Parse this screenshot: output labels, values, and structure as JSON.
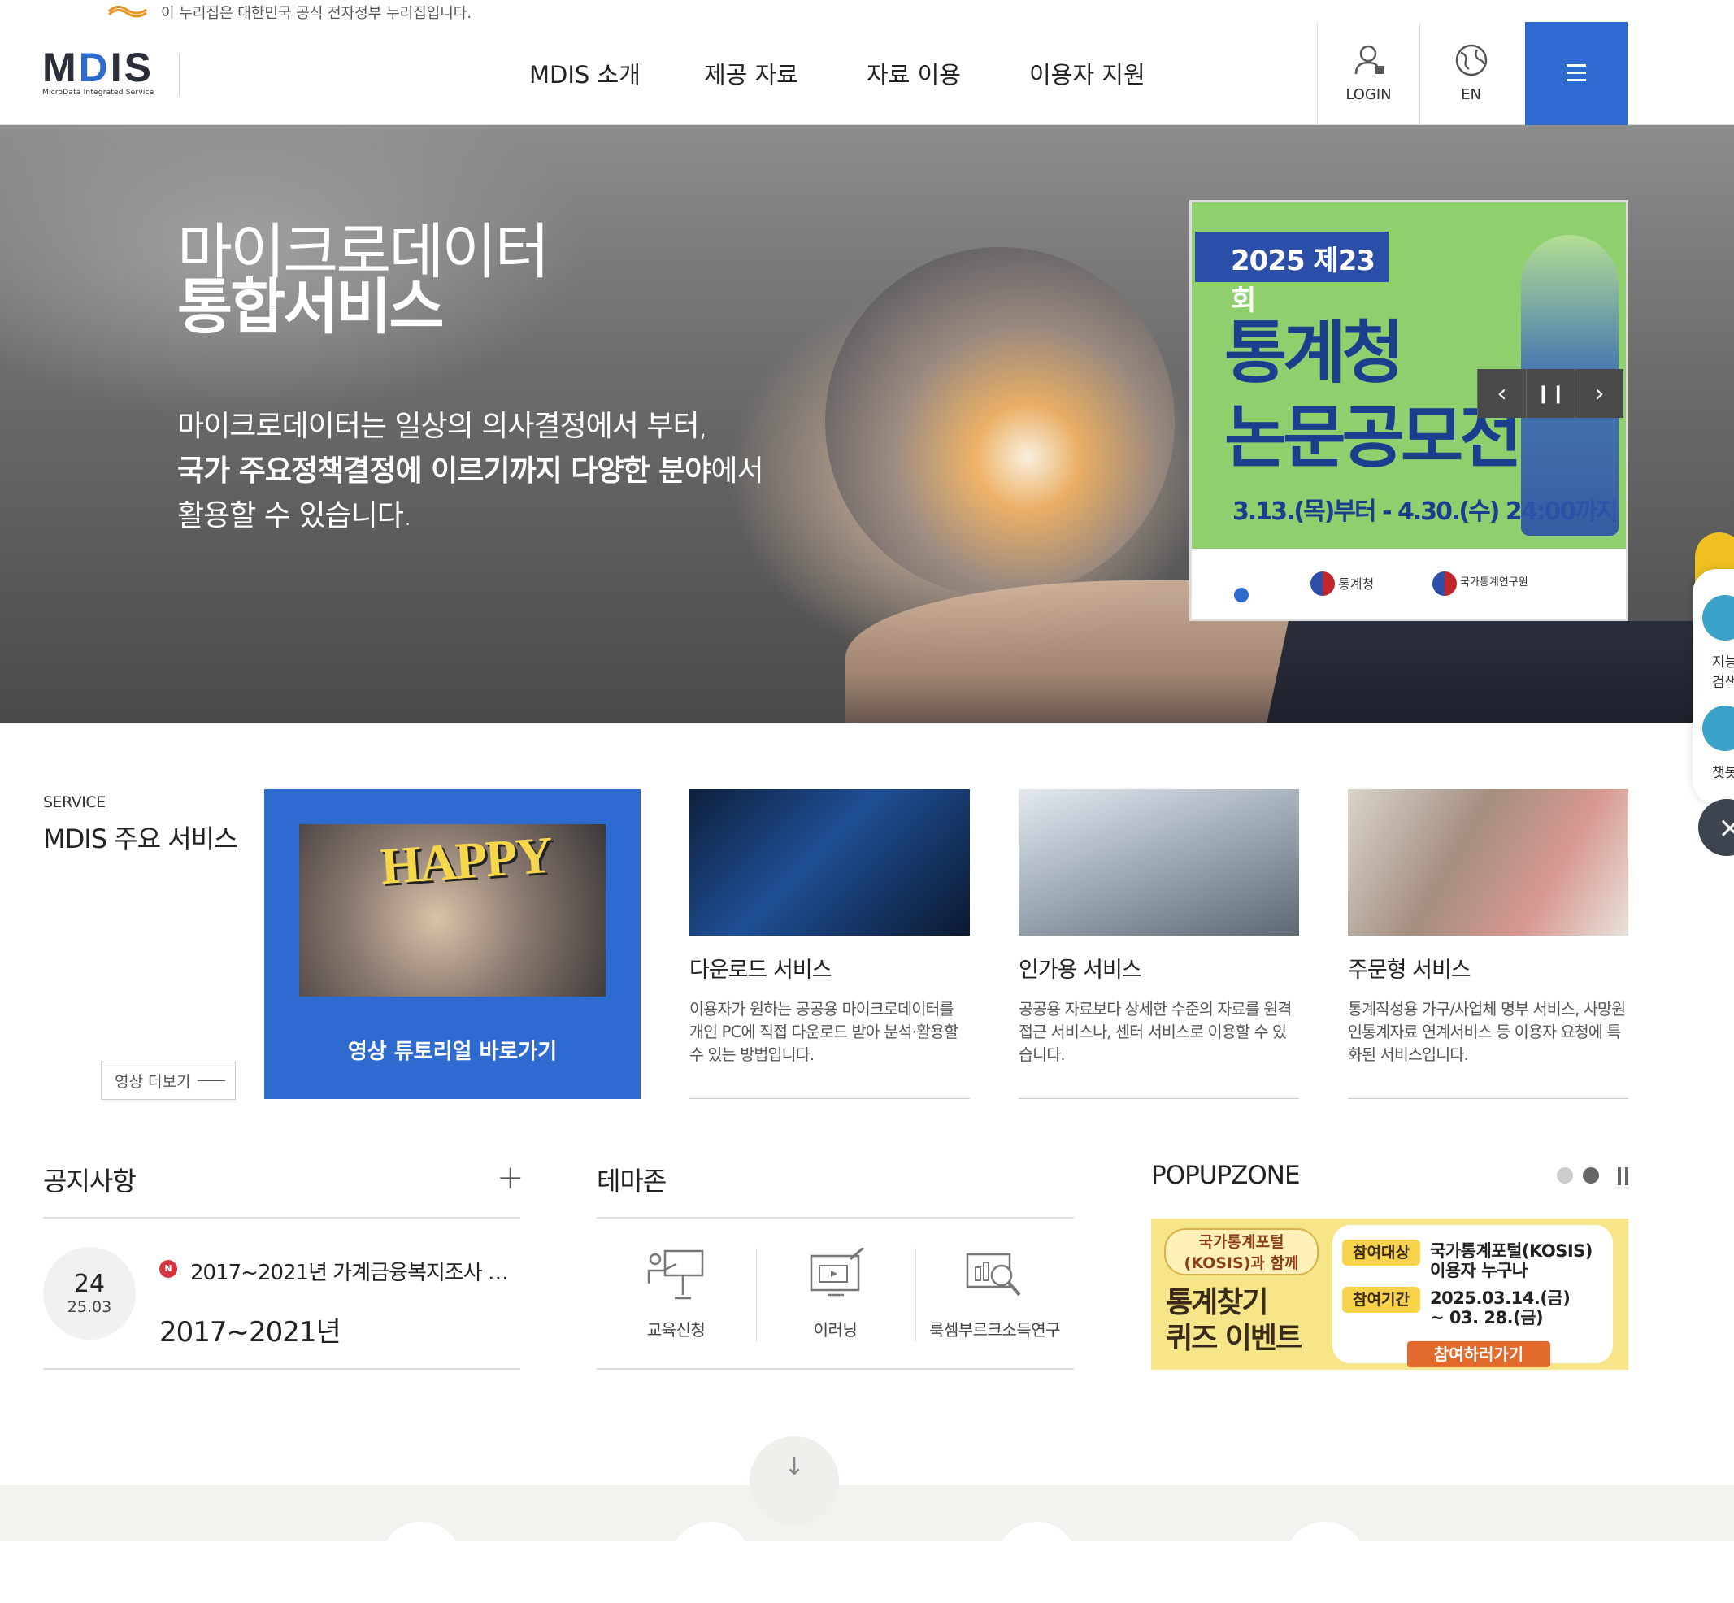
{
  "gov_banner": {
    "text": "이 누리집은 대한민국 공식 전자정부 누리집입니다."
  },
  "header": {
    "logo_text": "MDIS",
    "logo_sub": "MicroData Integrated Service",
    "nav": [
      "MDIS 소개",
      "제공 자료",
      "자료 이용",
      "이용자 지원"
    ],
    "login_label": "LOGIN",
    "lang_label": "EN",
    "menu_icon": "hamburger-icon",
    "accent_color": "#2e6bd0"
  },
  "hero": {
    "title_line1": "마이크로데이터",
    "title_line2": "통합서비스",
    "desc_line1": "마이크로데이터는 일상의 의사결정에서 부터,",
    "desc_line2_bold": "국가 주요정책결정에 이르기까지 다양한 분야",
    "desc_line2_rest": "에서",
    "desc_line3": "활용할 수 있습니다."
  },
  "contest_banner": {
    "badge": "2025 제23회",
    "line1": "통계청",
    "line2": "논문공모전",
    "date_text": "3.13.(목)부터 - 4.30.(수) 24:00까지",
    "logo1_text": "통계청",
    "logo2_text": "국가통계연구원",
    "controls": {
      "prev_icon": "chevron-left-icon",
      "pause_icon": "pause-icon",
      "next_icon": "chevron-right-icon"
    }
  },
  "floating": {
    "search_label": "지능형 검색",
    "chatbot_label": "챗봇",
    "close_icon": "close-icon"
  },
  "services": {
    "label": "SERVICE",
    "title": "MDIS 주요 서비스",
    "more_video": "영상 더보기",
    "tutorial_text": "HAPPY",
    "tutorial_label": "영상 튜토리얼 바로가기",
    "cards": [
      {
        "title": "다운로드 서비스",
        "desc": "이용자가 원하는 공공용 마이크로데이터를 개인 PC에 직접 다운로드 받아 분석·활용할 수 있는 방법입니다."
      },
      {
        "title": "인가용 서비스",
        "desc": "공공용 자료보다 상세한 수준의 자료를 원격접근 서비스나, 센터 서비스로 이용할 수 있습니다."
      },
      {
        "title": "주문형 서비스",
        "desc": "통계작성용 가구/사업체 명부 서비스, 사망원인통계자료 연계서비스 등 이용자 요청에 특화된 서비스입니다."
      }
    ]
  },
  "notice": {
    "title": "공지사항",
    "plus_icon": "plus-icon",
    "date_day": "24",
    "date_ym": "25.03",
    "new_badge": "N",
    "item_title": "2017~2021년 가계금융복지조사 …",
    "item_sub": "2017~2021년"
  },
  "theme": {
    "title": "테마존",
    "items": [
      "교육신청",
      "이러닝",
      "룩셈부르크소득연구"
    ]
  },
  "popupzone": {
    "title": "POPUPZONE",
    "left_badge": "국가통계포털 (KOSIS)과 함께",
    "big1": "통계찾기",
    "big2": "퀴즈 이벤트",
    "tag1": "참여대상",
    "val1": "국가통계포털(KOSIS) 이용자 누구나",
    "tag2": "참여기간",
    "val2": "2025.03.14.(금) ~ 03. 28.(금)",
    "cta": "참여하러가기"
  }
}
